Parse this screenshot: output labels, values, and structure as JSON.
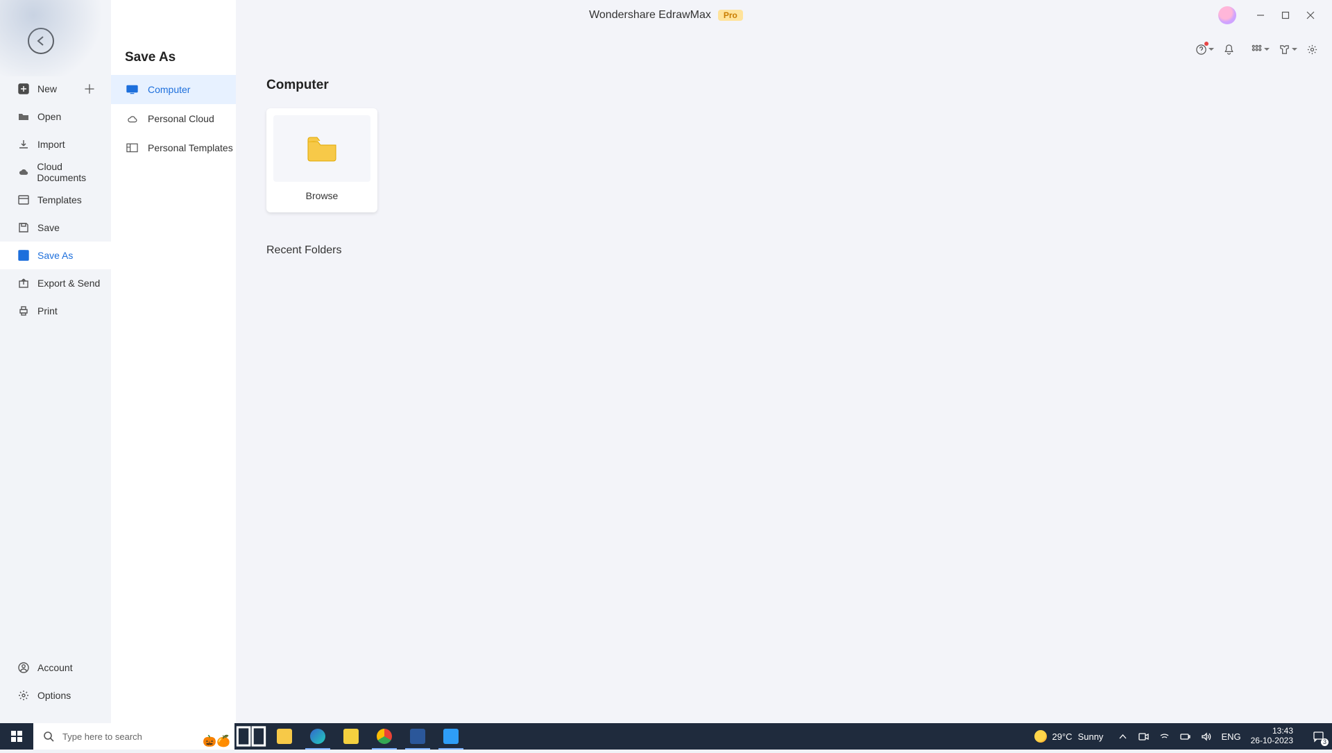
{
  "title_bar": {
    "app_name": "Wondershare EdrawMax",
    "badge": "Pro"
  },
  "toolbar_icons": {
    "help": "question-circle-icon",
    "bell": "bell-icon",
    "grid": "apps-grid-icon",
    "shirt": "theme-icon",
    "gear": "settings-icon"
  },
  "left_nav": {
    "back": "back-arrow-icon",
    "items": [
      {
        "label": "New",
        "icon": "plus-square-icon",
        "has_plus": true
      },
      {
        "label": "Open",
        "icon": "folder-icon"
      },
      {
        "label": "Import",
        "icon": "import-icon"
      },
      {
        "label": "Cloud Documents",
        "icon": "cloud-icon"
      },
      {
        "label": "Templates",
        "icon": "templates-icon"
      },
      {
        "label": "Save",
        "icon": "save-icon"
      },
      {
        "label": "Save As",
        "icon": "save-as-icon",
        "active": true
      },
      {
        "label": "Export & Send",
        "icon": "export-icon"
      },
      {
        "label": "Print",
        "icon": "print-icon"
      }
    ],
    "bottom": [
      {
        "label": "Account",
        "icon": "user-circle-icon"
      },
      {
        "label": "Options",
        "icon": "gear-icon"
      }
    ]
  },
  "mid_panel": {
    "title": "Save As",
    "items": [
      {
        "label": "Computer",
        "icon": "monitor-icon",
        "active": true
      },
      {
        "label": "Personal Cloud",
        "icon": "cloud-outline-icon"
      },
      {
        "label": "Personal Templates",
        "icon": "layout-icon"
      }
    ]
  },
  "main_panel": {
    "heading": "Computer",
    "browse_tile": {
      "label": "Browse",
      "icon": "folder-open-icon"
    },
    "recent_heading": "Recent Folders"
  },
  "taskbar": {
    "search_placeholder": "Type here to search",
    "weather": {
      "temp": "29°C",
      "cond": "Sunny"
    },
    "lang": "ENG",
    "time": "13:43",
    "date": "26-10-2023",
    "notif_count": "3"
  }
}
